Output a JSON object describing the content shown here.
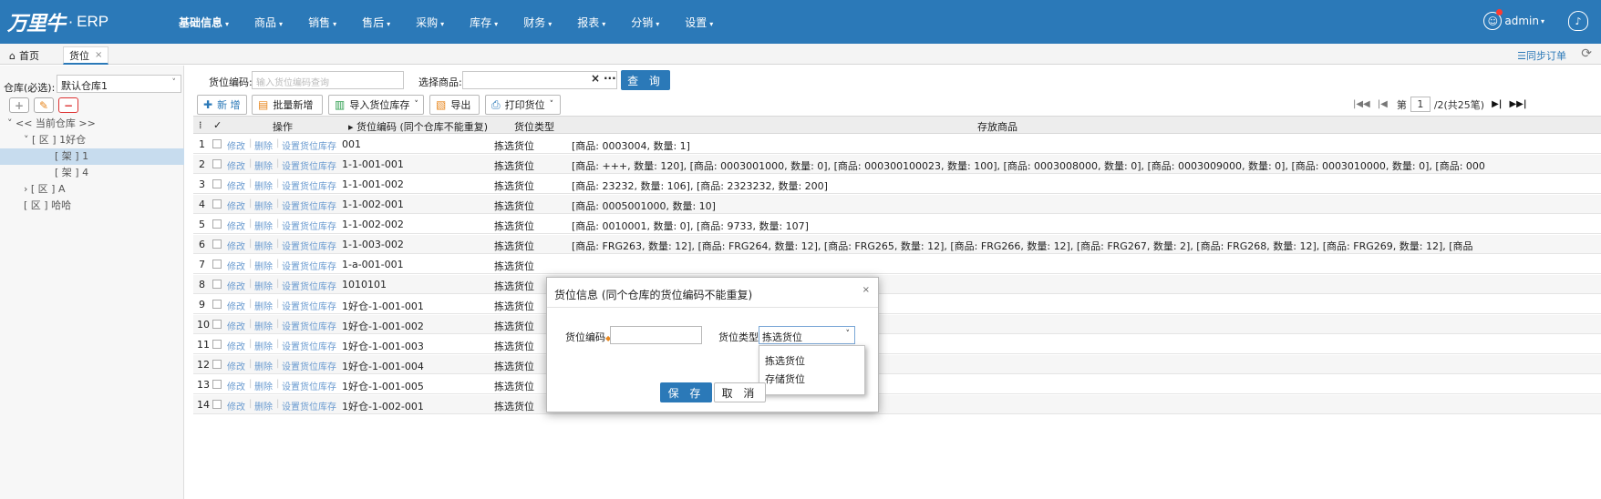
{
  "brand": {
    "logo": "万里牛",
    "dot": "·",
    "product": "ERP"
  },
  "nav": {
    "items": [
      "基础信息",
      "商品",
      "销售",
      "售后",
      "采购",
      "库存",
      "财务",
      "报表",
      "分销",
      "设置"
    ],
    "active": "基础信息",
    "caret": "▾"
  },
  "user": {
    "name": "admin",
    "caret": "▾"
  },
  "tabs": {
    "home": "首页",
    "current": "货位",
    "close": "×",
    "sync": "☰同步订单",
    "refresh": "⟳"
  },
  "left": {
    "warehouse_label": "仓库(必选):",
    "warehouse_value": "默认仓库1",
    "tree": [
      {
        "text": "˅ << 当前仓库 >>",
        "indent": 0,
        "selected": false
      },
      {
        "text": "˅ [ 区 ] 1好仓",
        "indent": 1,
        "selected": false
      },
      {
        "text": "[ 架 ] 1",
        "indent": 2,
        "selected": true
      },
      {
        "text": "[ 架 ] 4",
        "indent": 2,
        "selected": false
      },
      {
        "text": "› [ 区 ] A",
        "indent": 1,
        "selected": false
      },
      {
        "text": "[ 区 ] 哈哈",
        "indent": 1,
        "selected": false
      }
    ]
  },
  "search": {
    "code_label": "货位编码:",
    "code_placeholder": "输入货位编码查询",
    "goods_label": "选择商品:",
    "clear": "×",
    "more": "···",
    "query": "查 询"
  },
  "toolbar": {
    "add": "新 增",
    "batch_add": "批量新增",
    "import": "导入货位库存",
    "export": "导出",
    "print": "打印货位"
  },
  "pager": {
    "first": "|◀◀",
    "prev": "|◀",
    "page_label": "第",
    "page": "1",
    "total": "/2(共25笔)",
    "next": "▶|",
    "last": "▶▶|"
  },
  "grid": {
    "headers": {
      "idx": "⁞",
      "check": "✓",
      "ops": "操作",
      "code": "▸ 货位编码 (同个仓库不能重复)",
      "type": "货位类型",
      "goods": "存放商品"
    },
    "ops": {
      "edit": "修改",
      "delete": "删除",
      "stock": "设置货位库存",
      "sep": "|"
    },
    "rows": [
      {
        "idx": "1",
        "code": "001",
        "type": "拣选货位",
        "goods": "[商品: 0003004, 数量: 1]"
      },
      {
        "idx": "2",
        "code": "1-1-001-001",
        "type": "拣选货位",
        "goods": "[商品: +++, 数量: 120], [商品: 0003001000, 数量: 0], [商品: 000300100023, 数量: 100], [商品: 0003008000, 数量: 0], [商品: 0003009000, 数量: 0], [商品: 0003010000, 数量: 0], [商品: 000"
      },
      {
        "idx": "3",
        "code": "1-1-001-002",
        "type": "拣选货位",
        "goods": "[商品: 23232, 数量: 106], [商品: 2323232, 数量: 200]"
      },
      {
        "idx": "4",
        "code": "1-1-002-001",
        "type": "拣选货位",
        "goods": "[商品: 0005001000, 数量: 10]"
      },
      {
        "idx": "5",
        "code": "1-1-002-002",
        "type": "拣选货位",
        "goods": "[商品: 0010001, 数量: 0], [商品: 9733, 数量: 107]"
      },
      {
        "idx": "6",
        "code": "1-1-003-002",
        "type": "拣选货位",
        "goods": "[商品: FRG263, 数量: 12], [商品: FRG264, 数量: 12], [商品: FRG265, 数量: 12], [商品: FRG266, 数量: 12], [商品: FRG267, 数量: 2], [商品: FRG268, 数量: 12], [商品: FRG269, 数量: 12], [商品"
      },
      {
        "idx": "7",
        "code": "1-a-001-001",
        "type": "拣选货位",
        "goods": ""
      },
      {
        "idx": "8",
        "code": "1010101",
        "type": "拣选货位",
        "goods": ""
      },
      {
        "idx": "9",
        "code": "1好仓-1-001-001",
        "type": "拣选货位",
        "goods": ""
      },
      {
        "idx": "10",
        "code": "1好仓-1-001-002",
        "type": "拣选货位",
        "goods": ""
      },
      {
        "idx": "11",
        "code": "1好仓-1-001-003",
        "type": "拣选货位",
        "goods": ""
      },
      {
        "idx": "12",
        "code": "1好仓-1-001-004",
        "type": "拣选货位",
        "goods": ""
      },
      {
        "idx": "13",
        "code": "1好仓-1-001-005",
        "type": "拣选货位",
        "goods": ""
      },
      {
        "idx": "14",
        "code": "1好仓-1-002-001",
        "type": "拣选货位",
        "goods": ""
      }
    ]
  },
  "modal": {
    "title": "货位信息 (同个仓库的货位编码不能重复)",
    "close": "×",
    "code_label": "货位编码",
    "code_value": "",
    "type_label": "货位类型:",
    "type_value": "拣选货位",
    "type_options": [
      "拣选货位",
      "存储货位"
    ],
    "save": "保 存",
    "cancel": "取 消"
  },
  "colors": {
    "primary": "#2b79b8",
    "link": "#6a9bd0",
    "required": "#e8871e"
  }
}
